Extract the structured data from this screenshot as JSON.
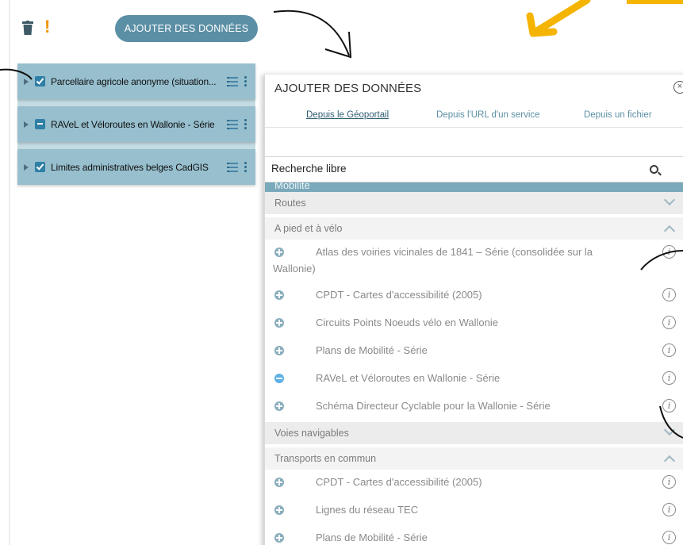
{
  "toolbar": {
    "warning_glyph": "!",
    "add_data_label": "AJOUTER DES DONNÉES",
    "colors": {
      "button": "#5b8fa5",
      "warning": "#f39200",
      "highlight_arrow": "#f4b400"
    }
  },
  "layers": [
    {
      "label": "Parcellaire agricole anonyme (situation...",
      "state": "checked"
    },
    {
      "label": "RAVeL et Véloroutes en Wallonie - Série",
      "state": "partial"
    },
    {
      "label": "Limites administratives belges CadGIS",
      "state": "checked"
    }
  ],
  "dialog": {
    "title": "AJOUTER DES DONNÉES",
    "close_glyph": "×",
    "tabs": [
      {
        "label": "Depuis le Géoportail",
        "active": true
      },
      {
        "label": "Depuis l'URL d'un service",
        "active": false
      },
      {
        "label": "Depuis un fichier",
        "active": false
      }
    ],
    "search_placeholder": "Recherche libre",
    "category": "Mobilité",
    "info_glyph": "i",
    "subcategories": [
      {
        "label": "Routes",
        "expanded": false
      },
      {
        "label": "A pied et à vélo",
        "expanded": true
      },
      {
        "label": "Voies navigables",
        "expanded": false
      },
      {
        "label": "Transports en commun",
        "expanded": true
      }
    ],
    "bike_items": [
      {
        "label": "Atlas des voiries vicinales de 1841 – Série (consolidée sur la Wallonie)",
        "added": false
      },
      {
        "label": "CPDT - Cartes d'accessibilité (2005)",
        "added": false
      },
      {
        "label": "Circuits Points Noeuds vélo en Wallonie",
        "added": false
      },
      {
        "label": "Plans de Mobilité - Série",
        "added": false
      },
      {
        "label": "RAVeL et Véloroutes en Wallonie - Série",
        "added": true
      },
      {
        "label": "Schéma Directeur Cyclable pour la Wallonie - Série",
        "added": false
      }
    ],
    "transit_items": [
      {
        "label": "CPDT - Cartes d'accessibilité (2005)",
        "added": false
      },
      {
        "label": "Lignes du réseau TEC",
        "added": false
      },
      {
        "label": "Plans de Mobilité - Série",
        "added": false
      }
    ]
  }
}
